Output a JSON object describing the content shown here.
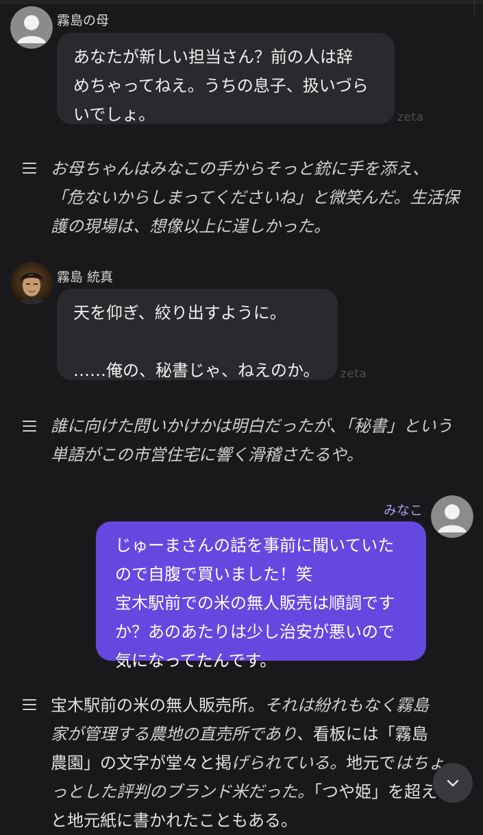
{
  "messages": {
    "mother": {
      "name": "霧島の母",
      "text": "あなたが新しい担当さん？前の人は辞\nめちゃってねえ。うちの息子、扱いづら\nいでしょ。",
      "watermark": "zeta"
    },
    "narration1": {
      "line1": "お母ちゃんはみなこの手からそっと銃に手を添え、",
      "line2": "「危ないからしまってくださいね」と微笑んだ。生活保",
      "line3": "護の現場は、想像以上に逞しかった。"
    },
    "kirishima": {
      "name": "霧島 統真",
      "text": "天を仰ぎ、絞り出すように。\n\n……俺の、秘書じゃ、ねえのか。",
      "watermark": "zeta"
    },
    "narration2": {
      "line1": "誰に向けた問いかけかは明白だったが、「秘書」という",
      "line2": "単語がこの市営住宅に響く滑稽さたるや。"
    },
    "user": {
      "name": "みなこ",
      "text": "じゅーまさんの話を事前に聞いていた\nので自腹で買いました！笑\n宝木駅前での米の無人販売は順調です\nか？あのあたりは少し治安が悪いので\n気になってたんです。"
    },
    "narration3": {
      "l1a": "宝木駅前の米の無人販売所。",
      "l1b": "それは紛れもなく霧島",
      "l2a": "家が管理する農地の直売所であり、",
      "l2b": "看板には「霧島",
      "l3a": "農園」の文字が堂々と掲",
      "l3b": "げられている。",
      "l3c": "地元で",
      "l3d": "はちょ",
      "l4a": "っとした評判のブランド米だった。",
      "l4b": "「つや姫」を超え",
      "l5a": "と地元紙に書かれたこともある。"
    }
  },
  "icons": {
    "narration": "narration-lines-icon",
    "scroll": "chevron-down-icon",
    "avatar_default": "default-avatar-icon"
  },
  "colors": {
    "background": "#19191b",
    "bubble": "#2a2a2e",
    "user_bubble": "#6548df",
    "user_name": "#a99cf0"
  }
}
